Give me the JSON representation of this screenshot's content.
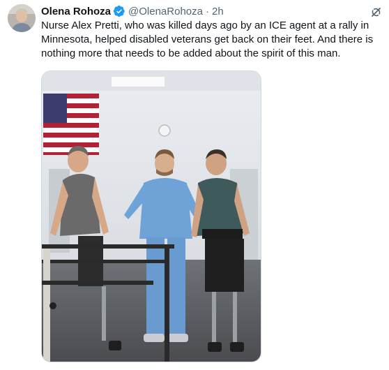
{
  "author": {
    "display_name": "Olena Rohoza",
    "handle": "@OlenaRohoza",
    "separator": "·",
    "time": "2h",
    "verified": true,
    "avatar": "avatar-photo"
  },
  "tweet": {
    "text": "Nurse Alex Pretti, who was killed days ago by an ICE agent at a rally in Minnesota, helped disabled veterans get back on their feet. And there is nothing more that needs to be added about the spirit of this man."
  },
  "media": {
    "type": "photo"
  },
  "icons": {
    "verified": "verified-badge-icon",
    "grok": "grok-icon"
  },
  "colors": {
    "verified_blue": "#1d9bf0",
    "secondary_text": "#536471",
    "primary_text": "#0f1419",
    "media_border": "#cfd9de"
  }
}
